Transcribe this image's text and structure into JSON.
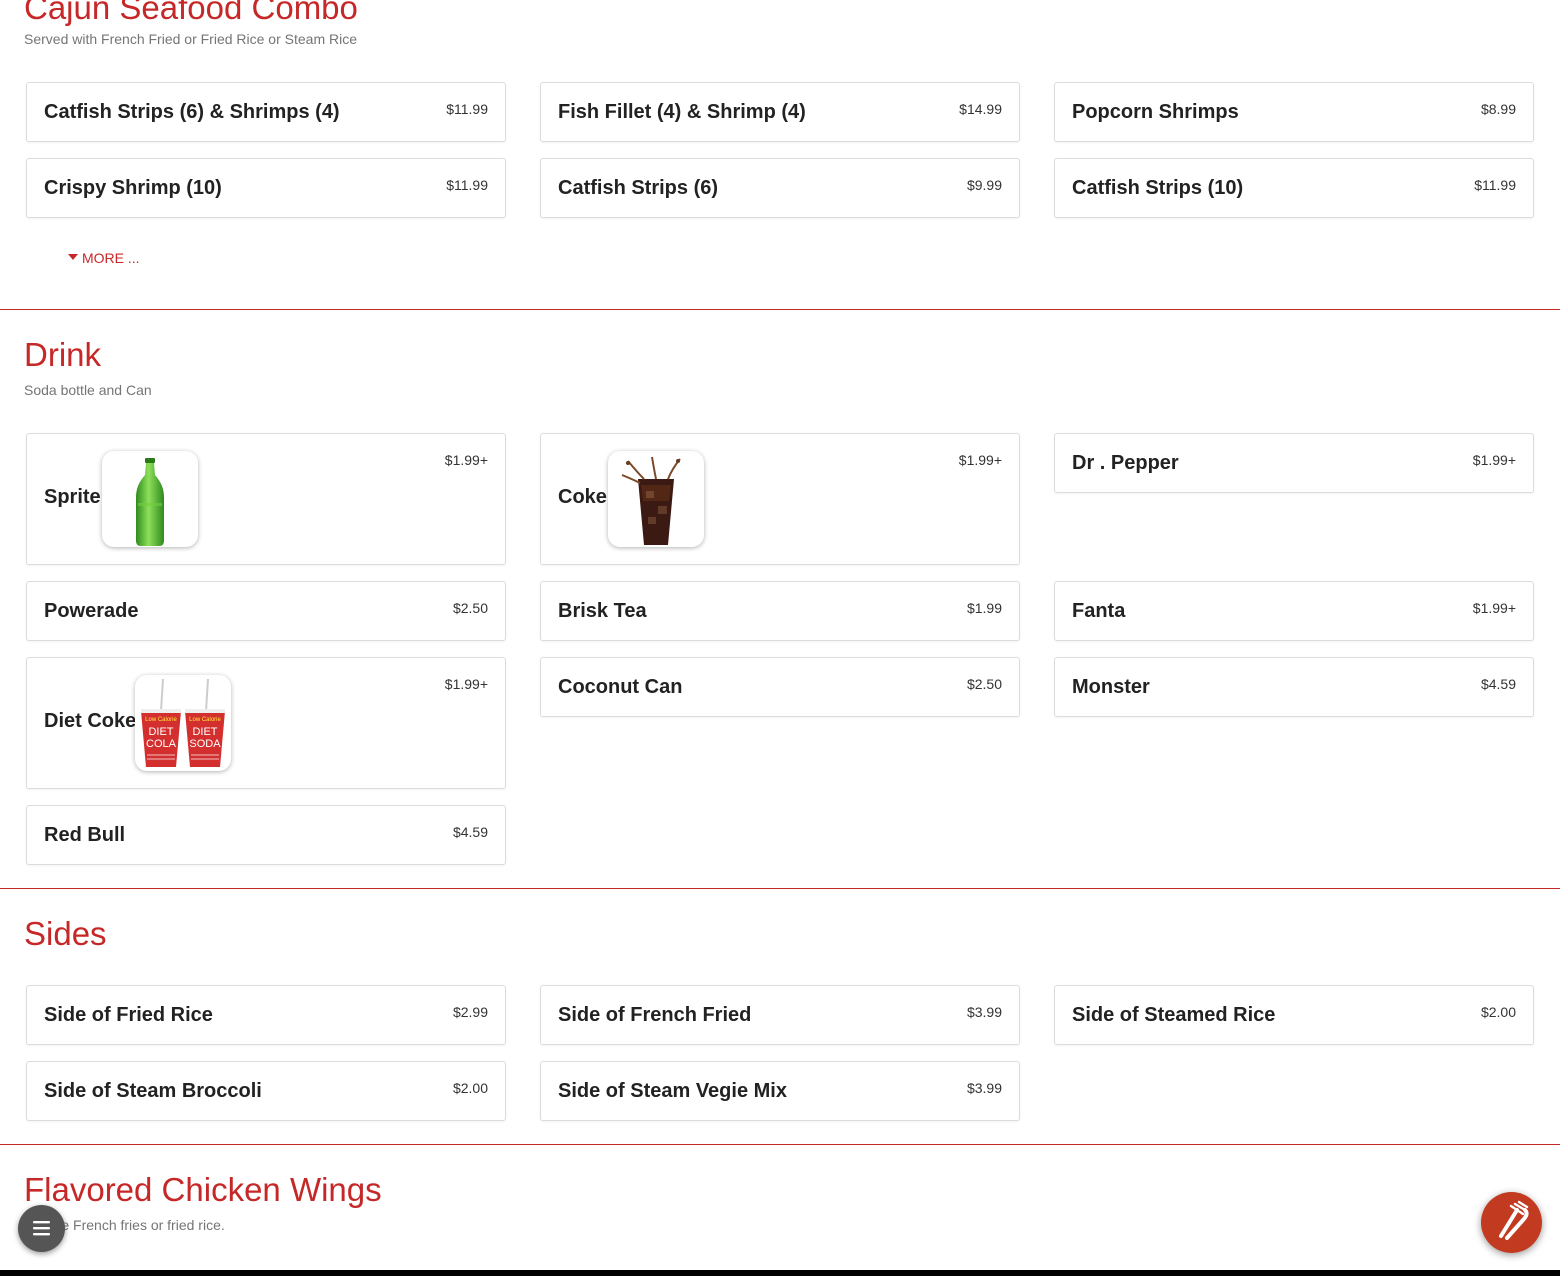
{
  "sections": {
    "cajun": {
      "title": "Cajun Seafood Combo",
      "subtitle": "Served with French Fried or Fried Rice or Steam Rice",
      "more_label": "MORE ...",
      "items": [
        {
          "name": "Catfish Strips (6) & Shrimps (4)",
          "price": "$11.99"
        },
        {
          "name": "Fish Fillet (4) & Shrimp (4)",
          "price": "$14.99"
        },
        {
          "name": "Popcorn Shrimps",
          "price": "$8.99"
        },
        {
          "name": "Crispy Shrimp (10)",
          "price": "$11.99"
        },
        {
          "name": "Catfish Strips (6)",
          "price": "$9.99"
        },
        {
          "name": "Catfish Strips (10)",
          "price": "$11.99"
        }
      ]
    },
    "drink": {
      "title": "Drink",
      "subtitle": "Soda bottle and Can",
      "items": [
        {
          "name": "Sprite",
          "price": "$1.99+",
          "image": "green-soda-bottle"
        },
        {
          "name": "Coke",
          "price": "$1.99+",
          "image": "cola-glass-with-ice"
        },
        {
          "name": "Dr . Pepper",
          "price": "$1.99+"
        },
        {
          "name": "Powerade",
          "price": "$2.50"
        },
        {
          "name": "Brisk Tea",
          "price": "$1.99"
        },
        {
          "name": "Fanta",
          "price": "$1.99+"
        },
        {
          "name": "Diet Coke",
          "price": "$1.99+",
          "image": "diet-cola-cups",
          "image_text": {
            "cup1_top": "Low Calorie",
            "cup1_main": "DIET",
            "cup1_sub": "COLA",
            "cup2_top": "Low Calorie",
            "cup2_main": "DIET",
            "cup2_sub": "SODA"
          }
        },
        {
          "name": "Coconut Can",
          "price": "$2.50"
        },
        {
          "name": "Monster",
          "price": "$4.59"
        },
        {
          "name": "Red Bull",
          "price": "$4.59"
        }
      ]
    },
    "sides": {
      "title": "Sides",
      "items": [
        {
          "name": "Side of Fried Rice",
          "price": "$2.99"
        },
        {
          "name": "Side of French Fried",
          "price": "$3.99"
        },
        {
          "name": "Side of Steamed Rice",
          "price": "$2.00"
        },
        {
          "name": "Side of Steam Broccoli",
          "price": "$2.00"
        },
        {
          "name": "Side of Steam Vegie Mix",
          "price": "$3.99"
        }
      ]
    },
    "wings": {
      "title": "Flavored Chicken Wings",
      "subtitle": "Include French fries or fried rice."
    }
  },
  "fab": {
    "menu_icon": "hamburger-menu-icon",
    "order_icon": "utensils-icon"
  },
  "colors": {
    "accent": "#c62828",
    "fab_order": "#c23a1f",
    "fab_menu": "#555555"
  }
}
